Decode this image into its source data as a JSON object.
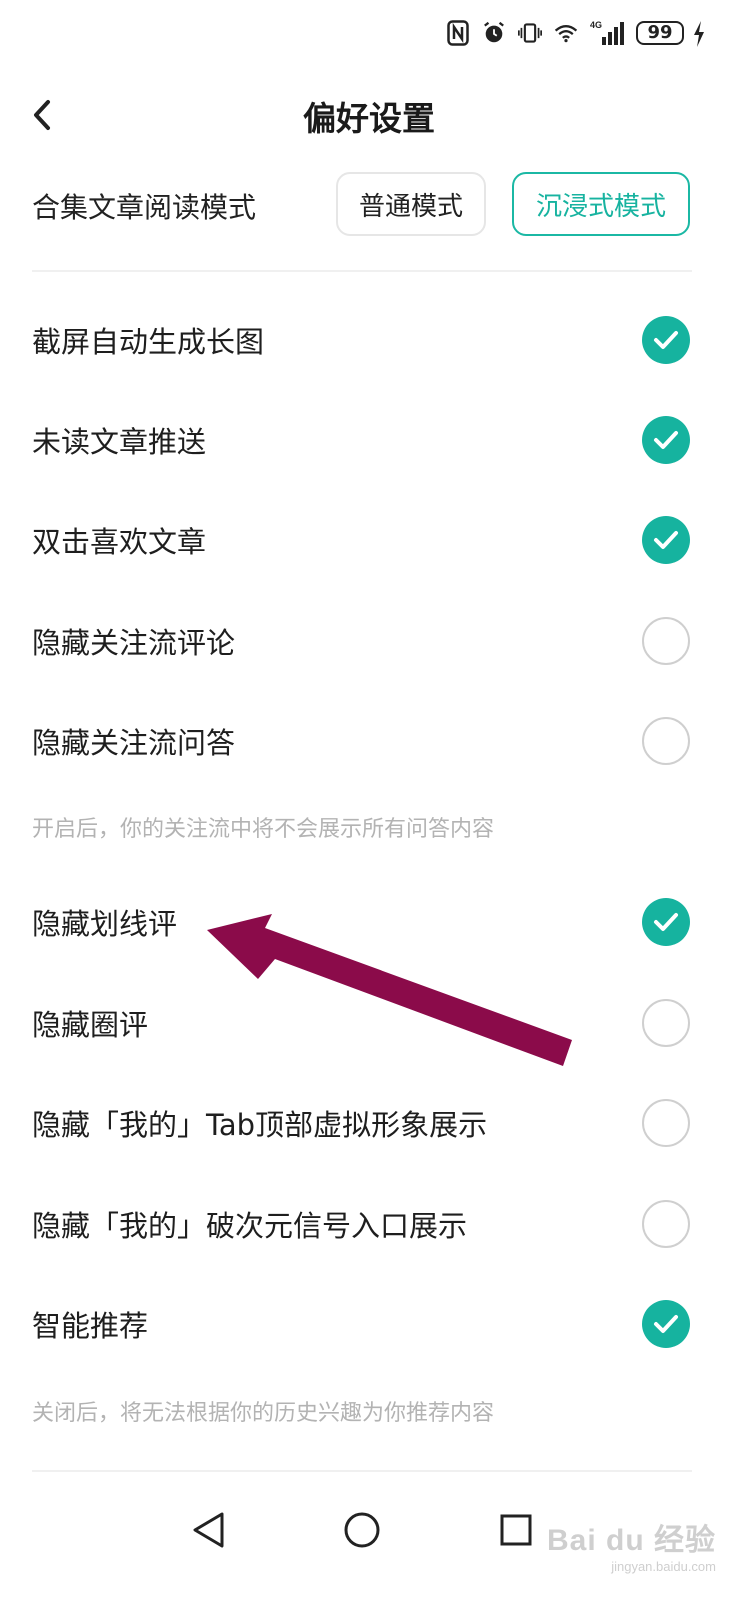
{
  "status_bar": {
    "battery": "99",
    "network": "4G",
    "icons": [
      "nfc-icon",
      "alarm-icon",
      "vibrate-icon",
      "wifi-icon",
      "signal-icon",
      "battery-icon",
      "charging-icon"
    ]
  },
  "header": {
    "title": "偏好设置",
    "back_icon": "chevron-left-icon"
  },
  "reading_mode": {
    "label": "合集文章阅读模式",
    "options": [
      "普通模式",
      "沉浸式模式"
    ],
    "selected": "沉浸式模式"
  },
  "settings": [
    {
      "label": "截屏自动生成长图",
      "checked": true
    },
    {
      "label": "未读文章推送",
      "checked": true
    },
    {
      "label": "双击喜欢文章",
      "checked": true
    },
    {
      "label": "隐藏关注流评论",
      "checked": false
    },
    {
      "label": "隐藏关注流问答",
      "checked": false
    },
    {
      "label": "隐藏划线评",
      "checked": true
    },
    {
      "label": "隐藏圈评",
      "checked": false
    },
    {
      "label": "隐藏「我的」Tab顶部虚拟形象展示",
      "checked": false
    },
    {
      "label": "隐藏「我的」破次元信号入口展示",
      "checked": false
    },
    {
      "label": "智能推荐",
      "checked": true
    }
  ],
  "hints": {
    "qa_hint": "开启后，你的关注流中将不会展示所有问答内容",
    "recommend_hint": "关闭后，将无法根据你的历史兴趣为你推荐内容"
  },
  "nav_bar": {
    "icons": [
      "back-triangle-icon",
      "home-circle-icon",
      "recents-square-icon"
    ]
  },
  "watermark": {
    "main": "Bai du 经验",
    "sub": "jingyan.baidu.com"
  },
  "colors": {
    "accent": "#16b39f",
    "arrow": "#8b0b4a",
    "hint_text": "#b3b3b3"
  }
}
